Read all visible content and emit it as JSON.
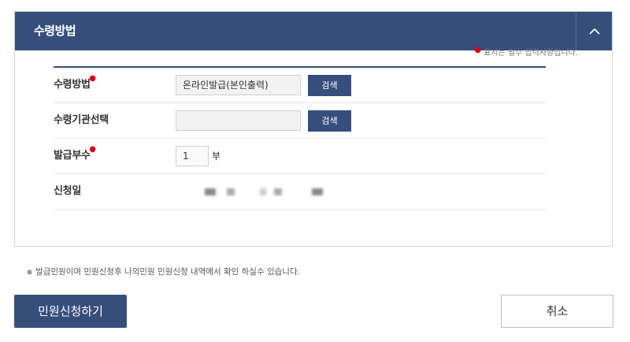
{
  "panel": {
    "title": "수령방법",
    "collapse_icon": "chevron-up-icon",
    "required_note": "표시는 필수 입력사항입니다."
  },
  "form": {
    "receive_method": {
      "label": "수령방법",
      "value": "온라인발급(본인출력)",
      "search_label": "검색"
    },
    "receive_agency": {
      "label": "수령기관선택",
      "value": "",
      "search_label": "검색"
    },
    "copies": {
      "label": "발급부수",
      "value": "1",
      "unit": "부"
    },
    "apply_date": {
      "label": "신청일"
    }
  },
  "notice": "발급민원이며 민원신청후 나의민원 민원신청 내역에서 확인 하실수 있습니다.",
  "buttons": {
    "submit": "민원신청하기",
    "cancel": "취소"
  },
  "colors": {
    "accent": "#354e7c",
    "required": "#d6001c"
  }
}
